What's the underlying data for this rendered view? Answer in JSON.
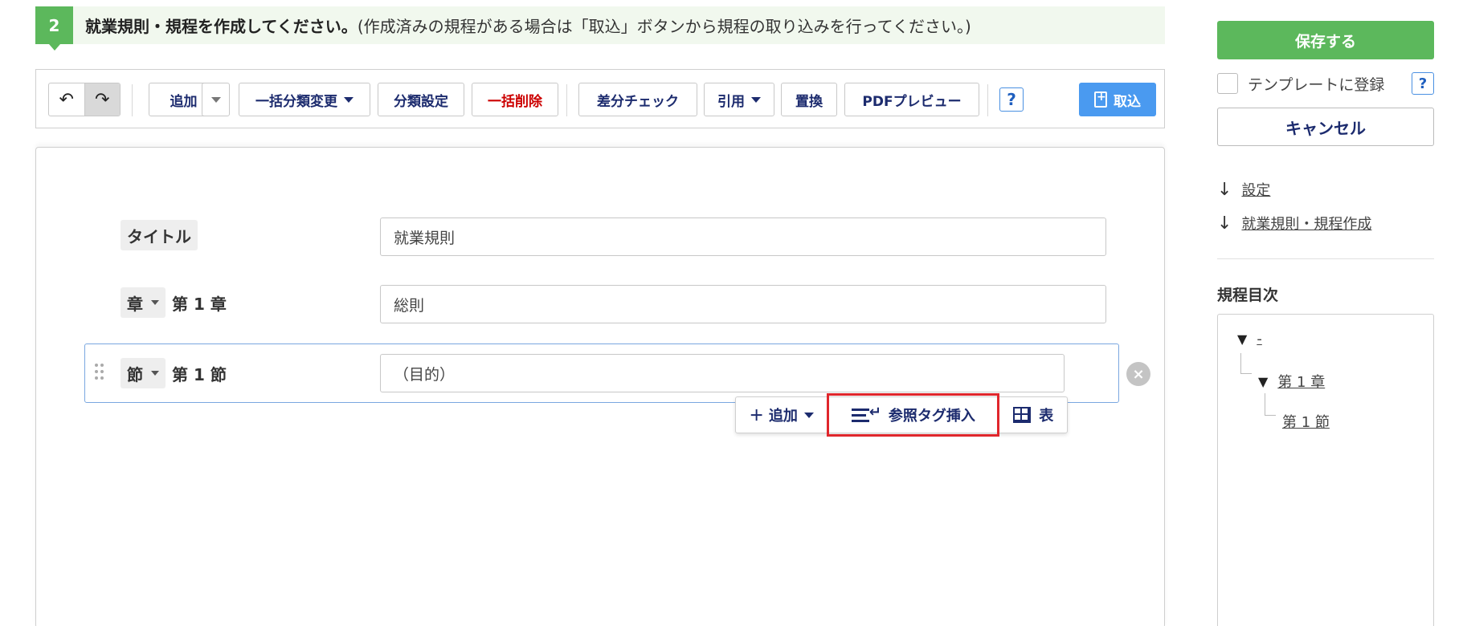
{
  "step": {
    "number": "2",
    "title": "就業規則・規程を作成してください。",
    "note": "(作成済みの規程がある場合は「取込」ボタンから規程の取り込みを行ってください。)"
  },
  "toolbar": {
    "undo": "↶",
    "redo": "↷",
    "add": "追加",
    "bulk_category": "一括分類変更",
    "category_settings": "分類設定",
    "bulk_delete": "一括削除",
    "diff_check": "差分チェック",
    "quote": "引用",
    "replace": "置換",
    "pdf_preview": "PDFプレビュー",
    "help": "?",
    "import": "取込"
  },
  "editor": {
    "title_row": {
      "label": "タイトル",
      "value": "就業規則"
    },
    "chapter_row": {
      "type": "章",
      "number": "第 1 章",
      "value": "総則"
    },
    "section_row": {
      "type": "節",
      "number": "第 1 節",
      "value": "（目的）",
      "clear": "×"
    }
  },
  "action_bar": {
    "add": "＋ 追加",
    "ref_tag": "参照タグ挿入",
    "table": "表"
  },
  "sidebar": {
    "save": "保存する",
    "template_label": "テンプレートに登録",
    "template_help": "?",
    "cancel": "キャンセル",
    "jump_arrow": "↓",
    "jump_settings": "設定",
    "jump_rules": "就業規則・規程作成",
    "toc_title": "規程目次",
    "toc_root": "-",
    "toc_chapter": "第 1 章",
    "toc_section": "第 1 節",
    "toc_tri": "▼"
  },
  "colors": {
    "green": "#5cb85c",
    "navy": "#1c2b6e",
    "red": "#cc0000",
    "blue": "#4a9af0",
    "highlight": "#e0262c"
  }
}
